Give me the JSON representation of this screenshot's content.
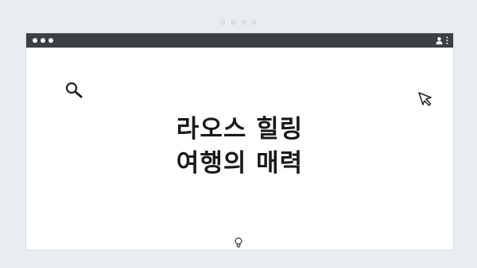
{
  "page": {
    "heading_line1": "라오스 힐링",
    "heading_line2": "여행의 매력"
  },
  "icons": {
    "search": "search-icon",
    "cursor": "cursor-icon",
    "bulb": "lightbulb-icon",
    "user": "user-icon",
    "menu": "kebab-menu-icon"
  },
  "colors": {
    "background": "#e9edf2",
    "titlebar": "#3c3f44",
    "card": "#ffffff",
    "text": "#1a1a1a"
  }
}
